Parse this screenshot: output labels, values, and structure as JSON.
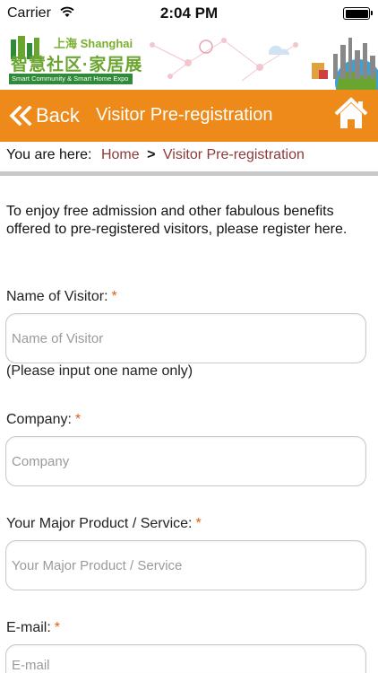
{
  "status_bar": {
    "carrier": "Carrier",
    "time": "2:04 PM"
  },
  "banner": {
    "logo_city_text": "上海 Shanghai",
    "logo_main_text": "智慧社区·家居展",
    "logo_sub_text": "Smart Community & Smart Home Expo",
    "logo_color": "#6aa530"
  },
  "nav": {
    "back_label": "Back",
    "title": "Visitor Pre-registration",
    "color": "#ee8a1a"
  },
  "breadcrumb": {
    "prefix": "You are here:",
    "home": "Home",
    "separator": ">",
    "current": "Visitor Pre-registration"
  },
  "intro": "To enjoy free admission and other fabulous benefits offered to pre-registered visitors, please register here.",
  "form": {
    "required_mark": "*",
    "name": {
      "label": "Name of Visitor:",
      "placeholder": "Name of Visitor",
      "hint": "(Please input one name only)"
    },
    "company": {
      "label": "Company:",
      "placeholder": "Company"
    },
    "product": {
      "label": "Your Major Product / Service:",
      "placeholder": "Your Major Product / Service"
    },
    "email": {
      "label": "E-mail:",
      "placeholder": "E-mail"
    }
  }
}
